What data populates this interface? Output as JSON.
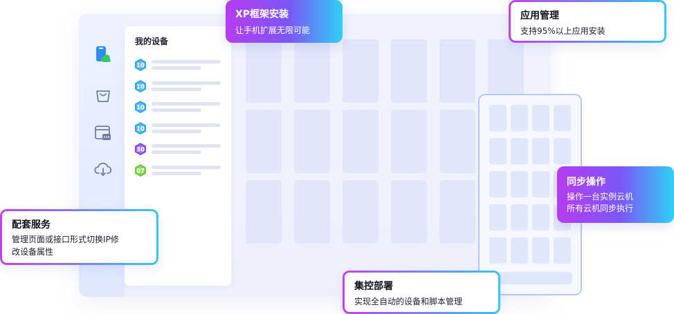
{
  "device_panel": {
    "title": "我的设备",
    "devices": [
      {
        "badge": "10",
        "color": "#2ea6f0"
      },
      {
        "badge": "10",
        "color": "#2ea6f0"
      },
      {
        "badge": "10",
        "color": "#2ea6f0"
      },
      {
        "badge": "10",
        "color": "#2ea6f0"
      },
      {
        "badge": "30",
        "color": "#8b46e8"
      },
      {
        "badge": "07",
        "color": "#6ccc2e"
      }
    ]
  },
  "nav": {
    "icons": [
      "phone-cloud-icon",
      "shopping-bag-icon",
      "window-chat-icon",
      "cloud-download-icon"
    ]
  },
  "callouts": {
    "xp_framework": {
      "title": "XP框架安装",
      "desc": "让手机扩展无限可能"
    },
    "app_management": {
      "title": "应用管理",
      "desc": "支持95%以上应用安装"
    },
    "sync_operation": {
      "title": "同步操作",
      "desc_line1": "操作一台实例云机",
      "desc_line2": "所有云机同步执行"
    },
    "support_services": {
      "title": "配套服务",
      "desc_line1": "管理页面或接口形式切换IP修",
      "desc_line2": "改设备属性"
    },
    "group_deploy": {
      "title": "集控部署",
      "desc": "实现全自动的设备和脚本管理"
    }
  },
  "colors": {
    "accent_purple": "#b53cf0",
    "accent_cyan": "#2fd0f5",
    "primary_blue": "#2f8cf5",
    "tile": "#e1e6fb"
  }
}
